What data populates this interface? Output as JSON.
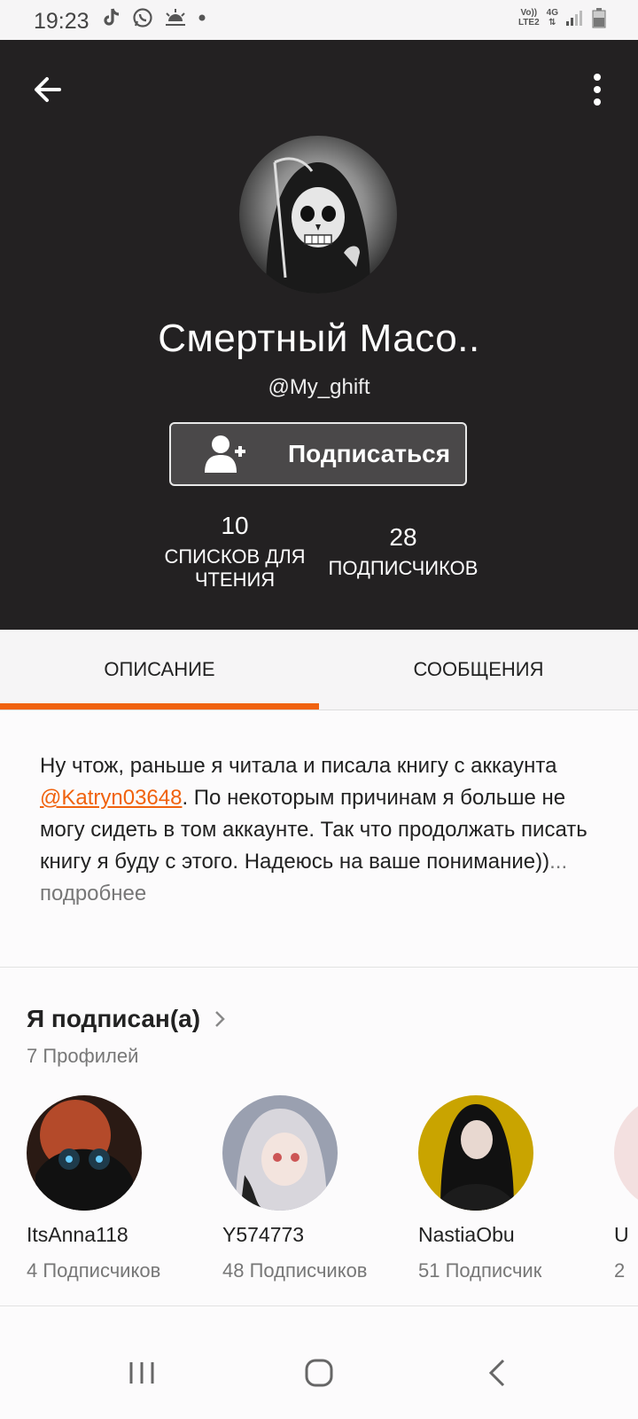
{
  "status_bar": {
    "time": "19:23",
    "network_top": "Vo))",
    "network_bottom": "LTE2",
    "signal_type": "4G"
  },
  "profile": {
    "display_name": "Смертный Масо..",
    "handle": "@My_ghift",
    "follow_label": "Подписаться",
    "stats": {
      "reading_lists_count": "10",
      "reading_lists_label_1": "СПИСКОВ ДЛЯ",
      "reading_lists_label_2": "ЧТЕНИЯ",
      "followers_count": "28",
      "followers_label": "ПОДПИСЧИКОВ"
    }
  },
  "tabs": [
    {
      "label": "ОПИСАНИЕ",
      "active": true
    },
    {
      "label": "СООБЩЕНИЯ",
      "active": false
    }
  ],
  "description": {
    "text_before": "Ну чтож, раньше я читала и писала книгу с аккаунта ",
    "mention": "@Katryn03648",
    "text_after": ". По некоторым причинам я больше не могу сидеть в том аккаунте. Так что продолжать писать книгу я буду с этого. Надеюсь на ваше понимание))",
    "more_label": "... подробнее"
  },
  "following": {
    "title": "Я подписан(а)",
    "count_label": "7 Профилей",
    "profiles": [
      {
        "username": "ItsAnna118",
        "followers": "4 Подписчиков"
      },
      {
        "username": "Y574773",
        "followers": "48 Подписчиков"
      },
      {
        "username": "NastiaObu",
        "followers": "51 Подписчик"
      },
      {
        "username": "U",
        "followers": "2"
      }
    ]
  },
  "colors": {
    "accent": "#f0620e",
    "header_bg": "#232122",
    "follow_button_bg": "#4a4849"
  },
  "icons": {
    "back": "arrow-left-icon",
    "more": "more-vertical-icon",
    "follow": "add-user-icon",
    "chevron": "chevron-right-icon",
    "nav_recents": "recents-icon",
    "nav_home": "home-icon",
    "nav_back": "back-chevron-icon"
  }
}
